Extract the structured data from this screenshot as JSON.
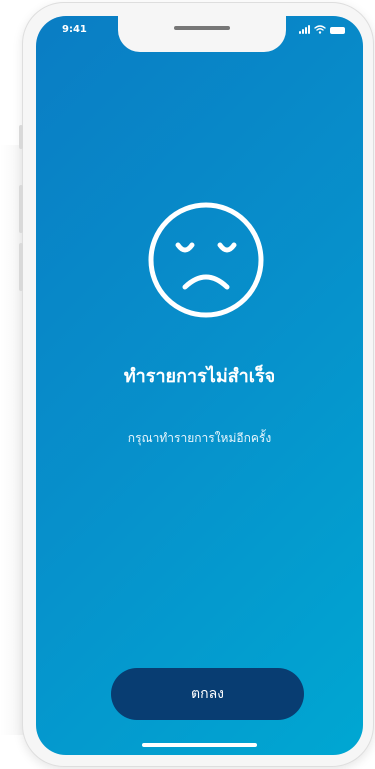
{
  "status_bar": {
    "time": "9:41"
  },
  "result": {
    "icon": "sad-face-icon",
    "title": "ทำรายการไม่สำเร็จ",
    "message": "กรุณาทำรายการใหม่อีกครั้ง"
  },
  "actions": {
    "ok_label": "ตกลง"
  },
  "colors": {
    "gradient_start": "#0a7dc4",
    "gradient_end": "#00a7d2",
    "button": "#083d72",
    "text": "#ffffff"
  }
}
